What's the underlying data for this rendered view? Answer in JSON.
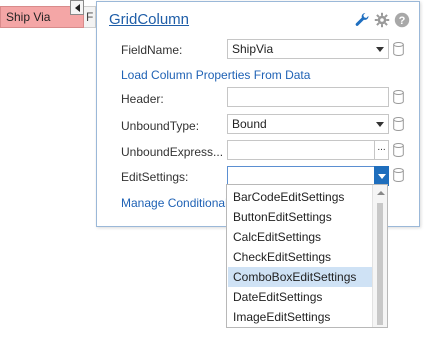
{
  "grid": {
    "column_header": "Ship Via",
    "next_column_fragment": "F"
  },
  "panel": {
    "title": "GridColumn",
    "icons": [
      "wrench-icon",
      "gear-icon",
      "help-icon"
    ],
    "rows": {
      "field_name_label": "FieldName:",
      "field_name_value": "ShipVia",
      "load_link": "Load Column Properties From Data",
      "header_label": "Header:",
      "header_value": "",
      "unbound_type_label": "UnboundType:",
      "unbound_type_value": "Bound",
      "unbound_expr_label": "UnboundExpress...",
      "unbound_expr_value": "",
      "unbound_expr_button": "...",
      "edit_settings_label": "EditSettings:",
      "edit_settings_value": "",
      "manage_link": "Manage Conditional"
    }
  },
  "dropdown": {
    "items": [
      "BarCodeEditSettings",
      "ButtonEditSettings",
      "CalcEditSettings",
      "CheckEditSettings",
      "ComboBoxEditSettings",
      "DateEditSettings",
      "ImageEditSettings"
    ],
    "selected": "ComboBoxEditSettings"
  },
  "colors": {
    "accent": "#1f62b5",
    "header_bg": "#f4a6a6",
    "selected_bg": "#cfe2f5",
    "combo_button": "#1e6ebd"
  }
}
